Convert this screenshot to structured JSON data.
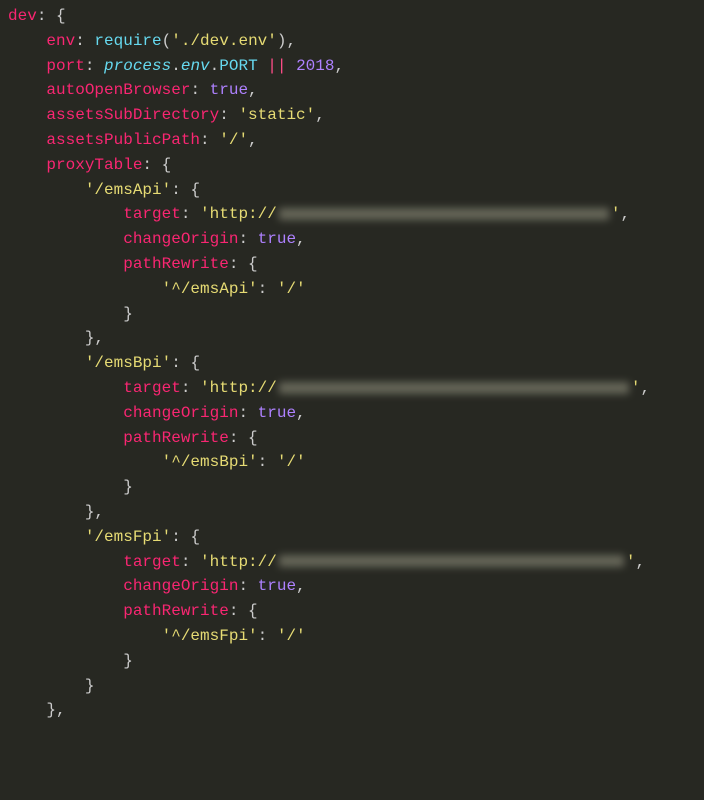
{
  "tokens": {
    "dev": "dev",
    "colon_brace": ": {",
    "env": "env",
    "require": "require",
    "env_path": "'./dev.env'",
    "port": "port",
    "process": "process",
    "dot": ".",
    "env_word": "env",
    "PORT": "PORT",
    "or": " || ",
    "port_num": "2018",
    "autoOpenBrowser": "autoOpenBrowser",
    "true": "true",
    "assetsSubDirectory": "assetsSubDirectory",
    "static": "'static'",
    "assetsPublicPath": "assetsPublicPath",
    "slash": "'/'",
    "proxyTable": "proxyTable",
    "emsApi": "'/emsApi'",
    "emsBpi": "'/emsBpi'",
    "emsFpi": "'/emsFpi'",
    "target": "target",
    "http": "'http://",
    "changeOrigin": "changeOrigin",
    "pathRewrite": "pathRewrite",
    "rewriteApi": "'^/emsApi'",
    "rewriteBpi": "'^/emsBpi'",
    "rewriteFpi": "'^/emsFpi'",
    "slash_val": "'/'",
    "comma": ",",
    "colon": ": ",
    "open_brace": "{",
    "close_brace": "}",
    "close_paren": ")",
    "open_paren": "(",
    "quote": "'"
  }
}
